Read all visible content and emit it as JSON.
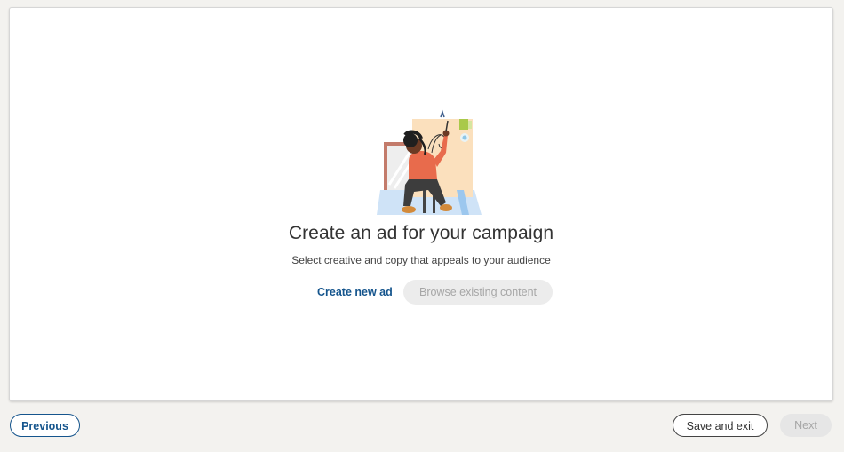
{
  "empty_state": {
    "headline": "Create an ad for your campaign",
    "subtext": "Select creative and copy that appeals to your audience",
    "illustration_icon": "person-painting-illustration"
  },
  "actions": {
    "create_new_label": "Create new ad",
    "browse_existing_label": "Browse existing content",
    "browse_existing_disabled": true
  },
  "footer": {
    "previous_label": "Previous",
    "save_exit_label": "Save and exit",
    "next_label": "Next",
    "next_disabled": true
  },
  "colors": {
    "page_background": "#f3f2ef",
    "card_background": "#ffffff",
    "accent": "#15558d",
    "disabled_bg": "#ececec",
    "disabled_text": "#a6a6a6"
  }
}
